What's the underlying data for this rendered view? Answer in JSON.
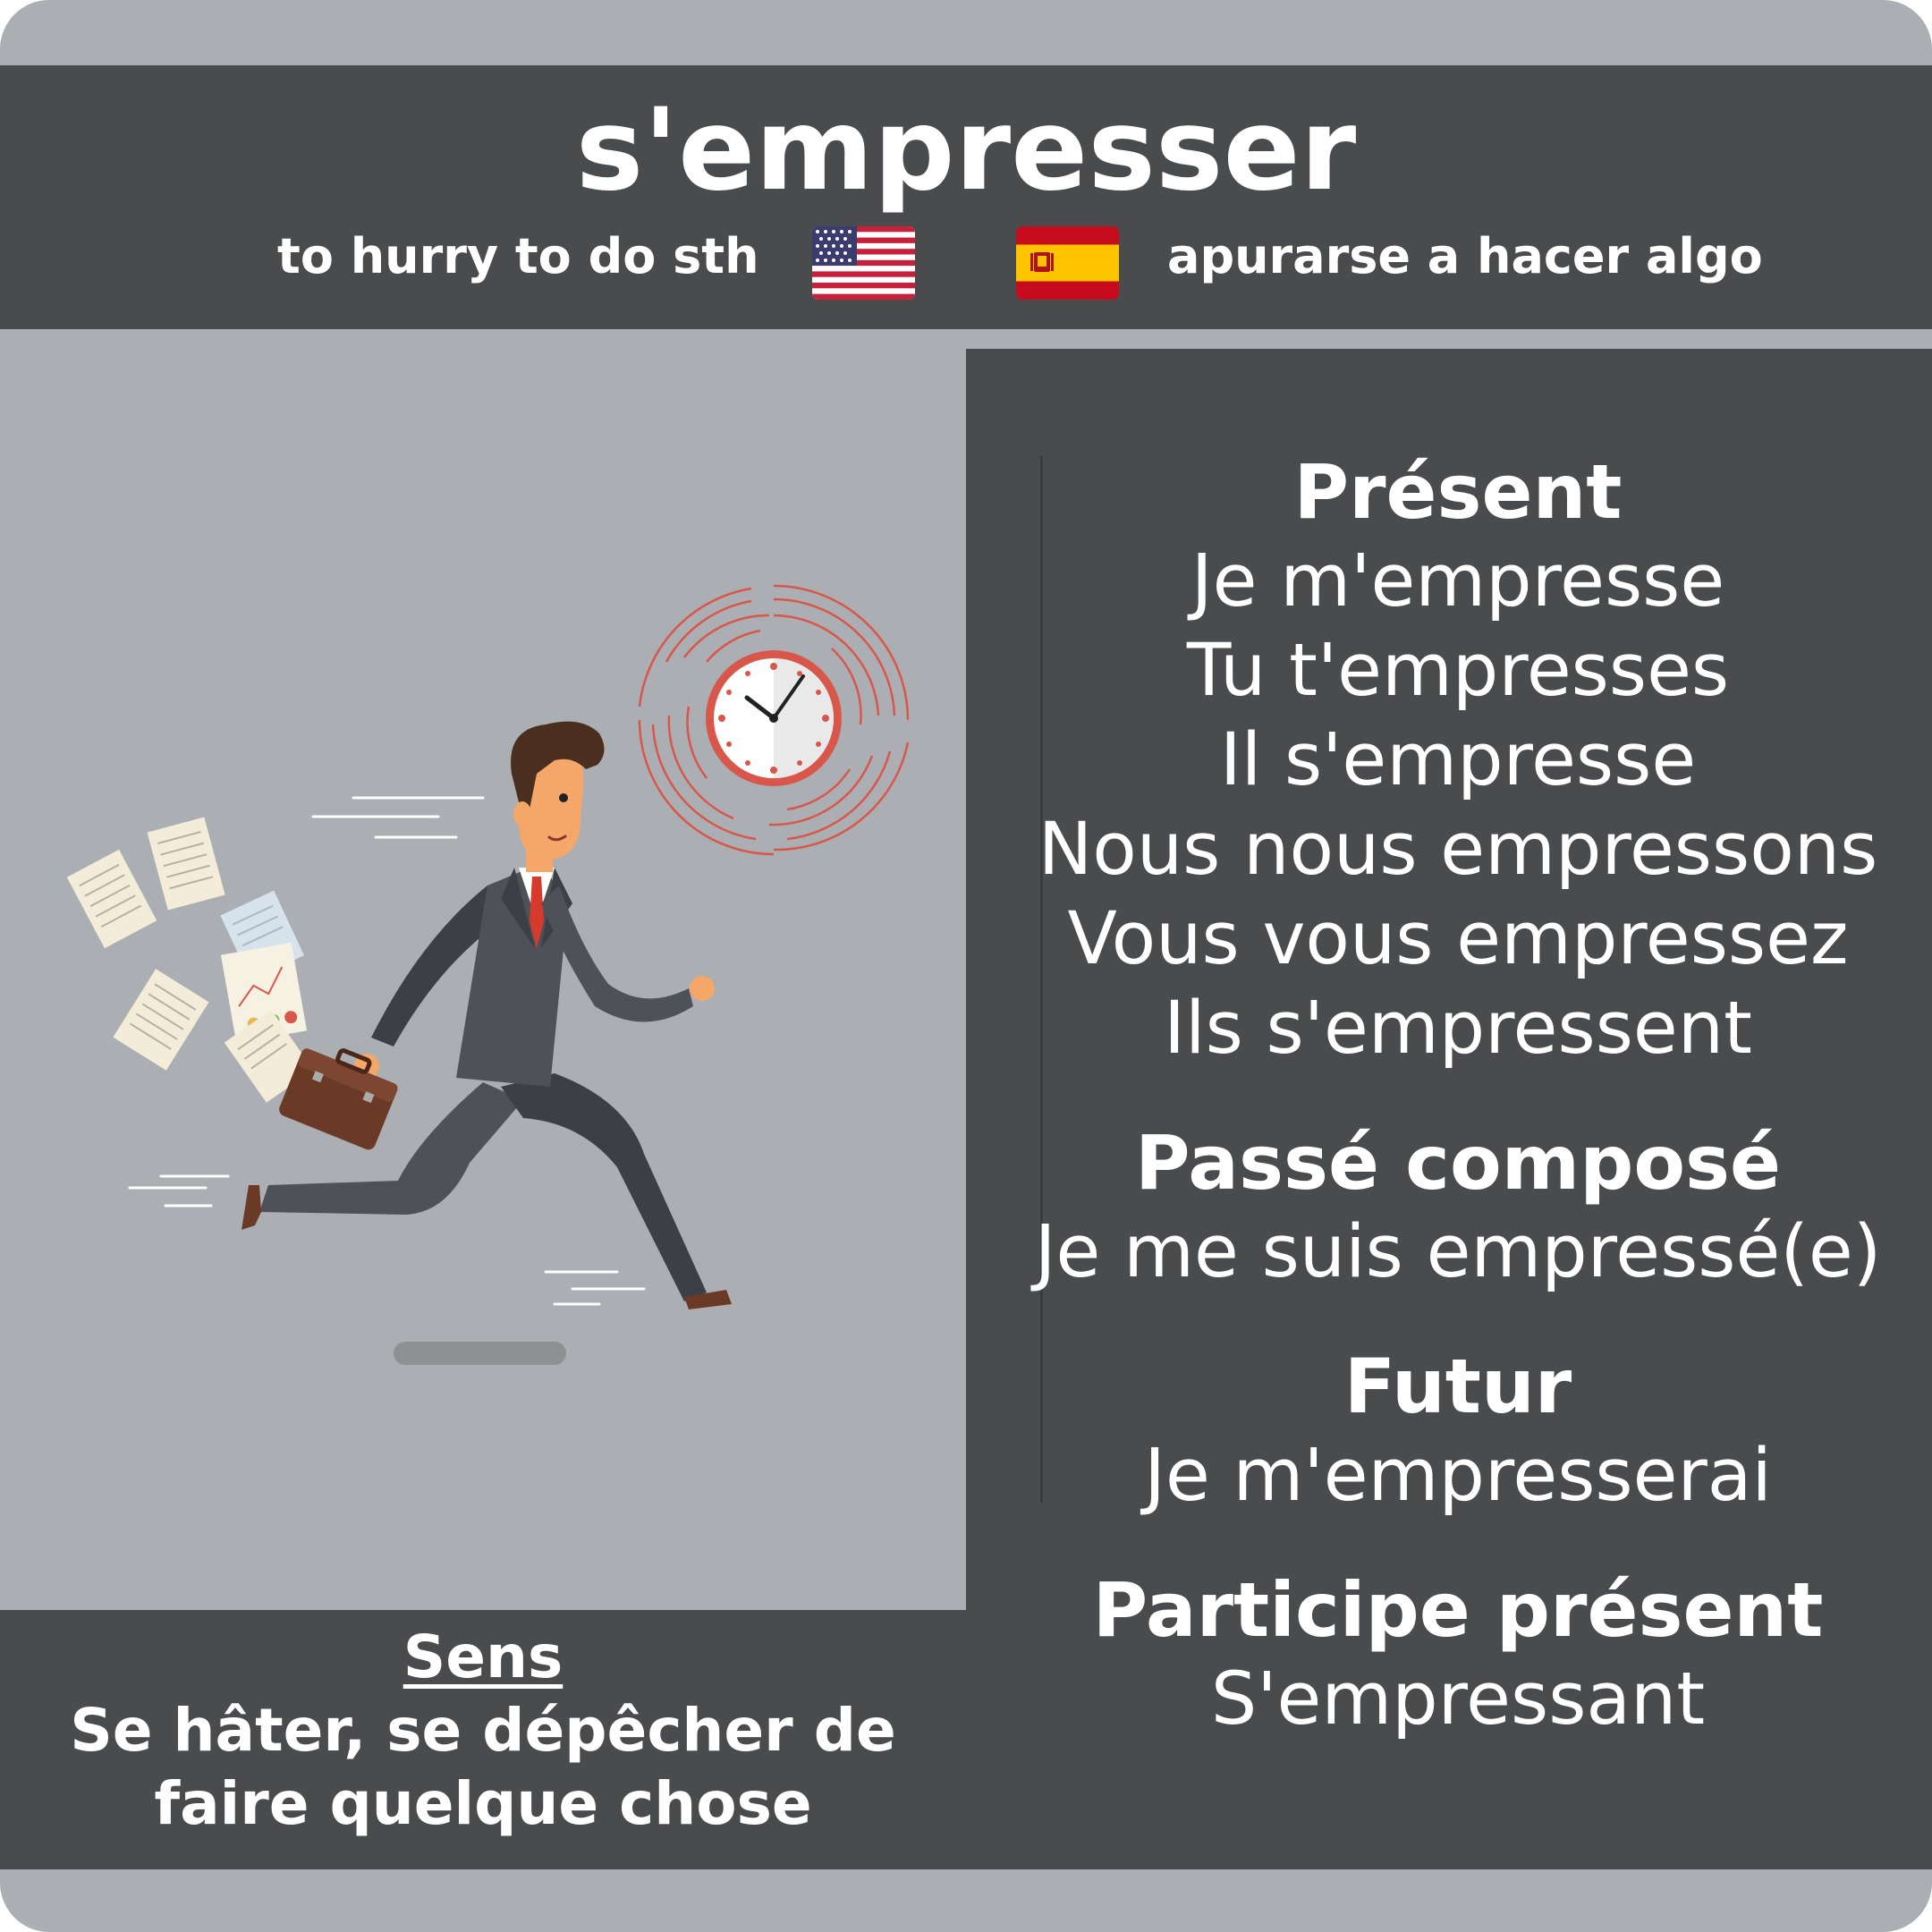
{
  "title": "s'empresser",
  "translations": {
    "en": "to hurry to do sth",
    "es": "apurarse a hacer algo",
    "en_flag_icon": "us-flag-icon",
    "es_flag_icon": "spain-flag-icon"
  },
  "illustration": "businessman-running-icon",
  "conjugation": {
    "present": {
      "label": "Présent",
      "forms": [
        "Je m'empresse",
        "Tu t'empresses",
        "Il s'empresse",
        "Nous nous empressons",
        "Vous vous empressez",
        "Ils s'empressent"
      ]
    },
    "passe_compose": {
      "label": "Passé composé",
      "form": "Je me suis empressé(e)"
    },
    "futur": {
      "label": "Futur",
      "form": "Je m'empresserai"
    },
    "participe_present": {
      "label": "Participe présent",
      "form": "S'empressant"
    }
  },
  "sens": {
    "title": "Sens",
    "lines": [
      "Se hâter, se dépêcher de",
      "faire quelque chose"
    ]
  },
  "colors": {
    "background": "#abafb3",
    "panel": "#4a4b4d",
    "text": "#ffffff"
  }
}
